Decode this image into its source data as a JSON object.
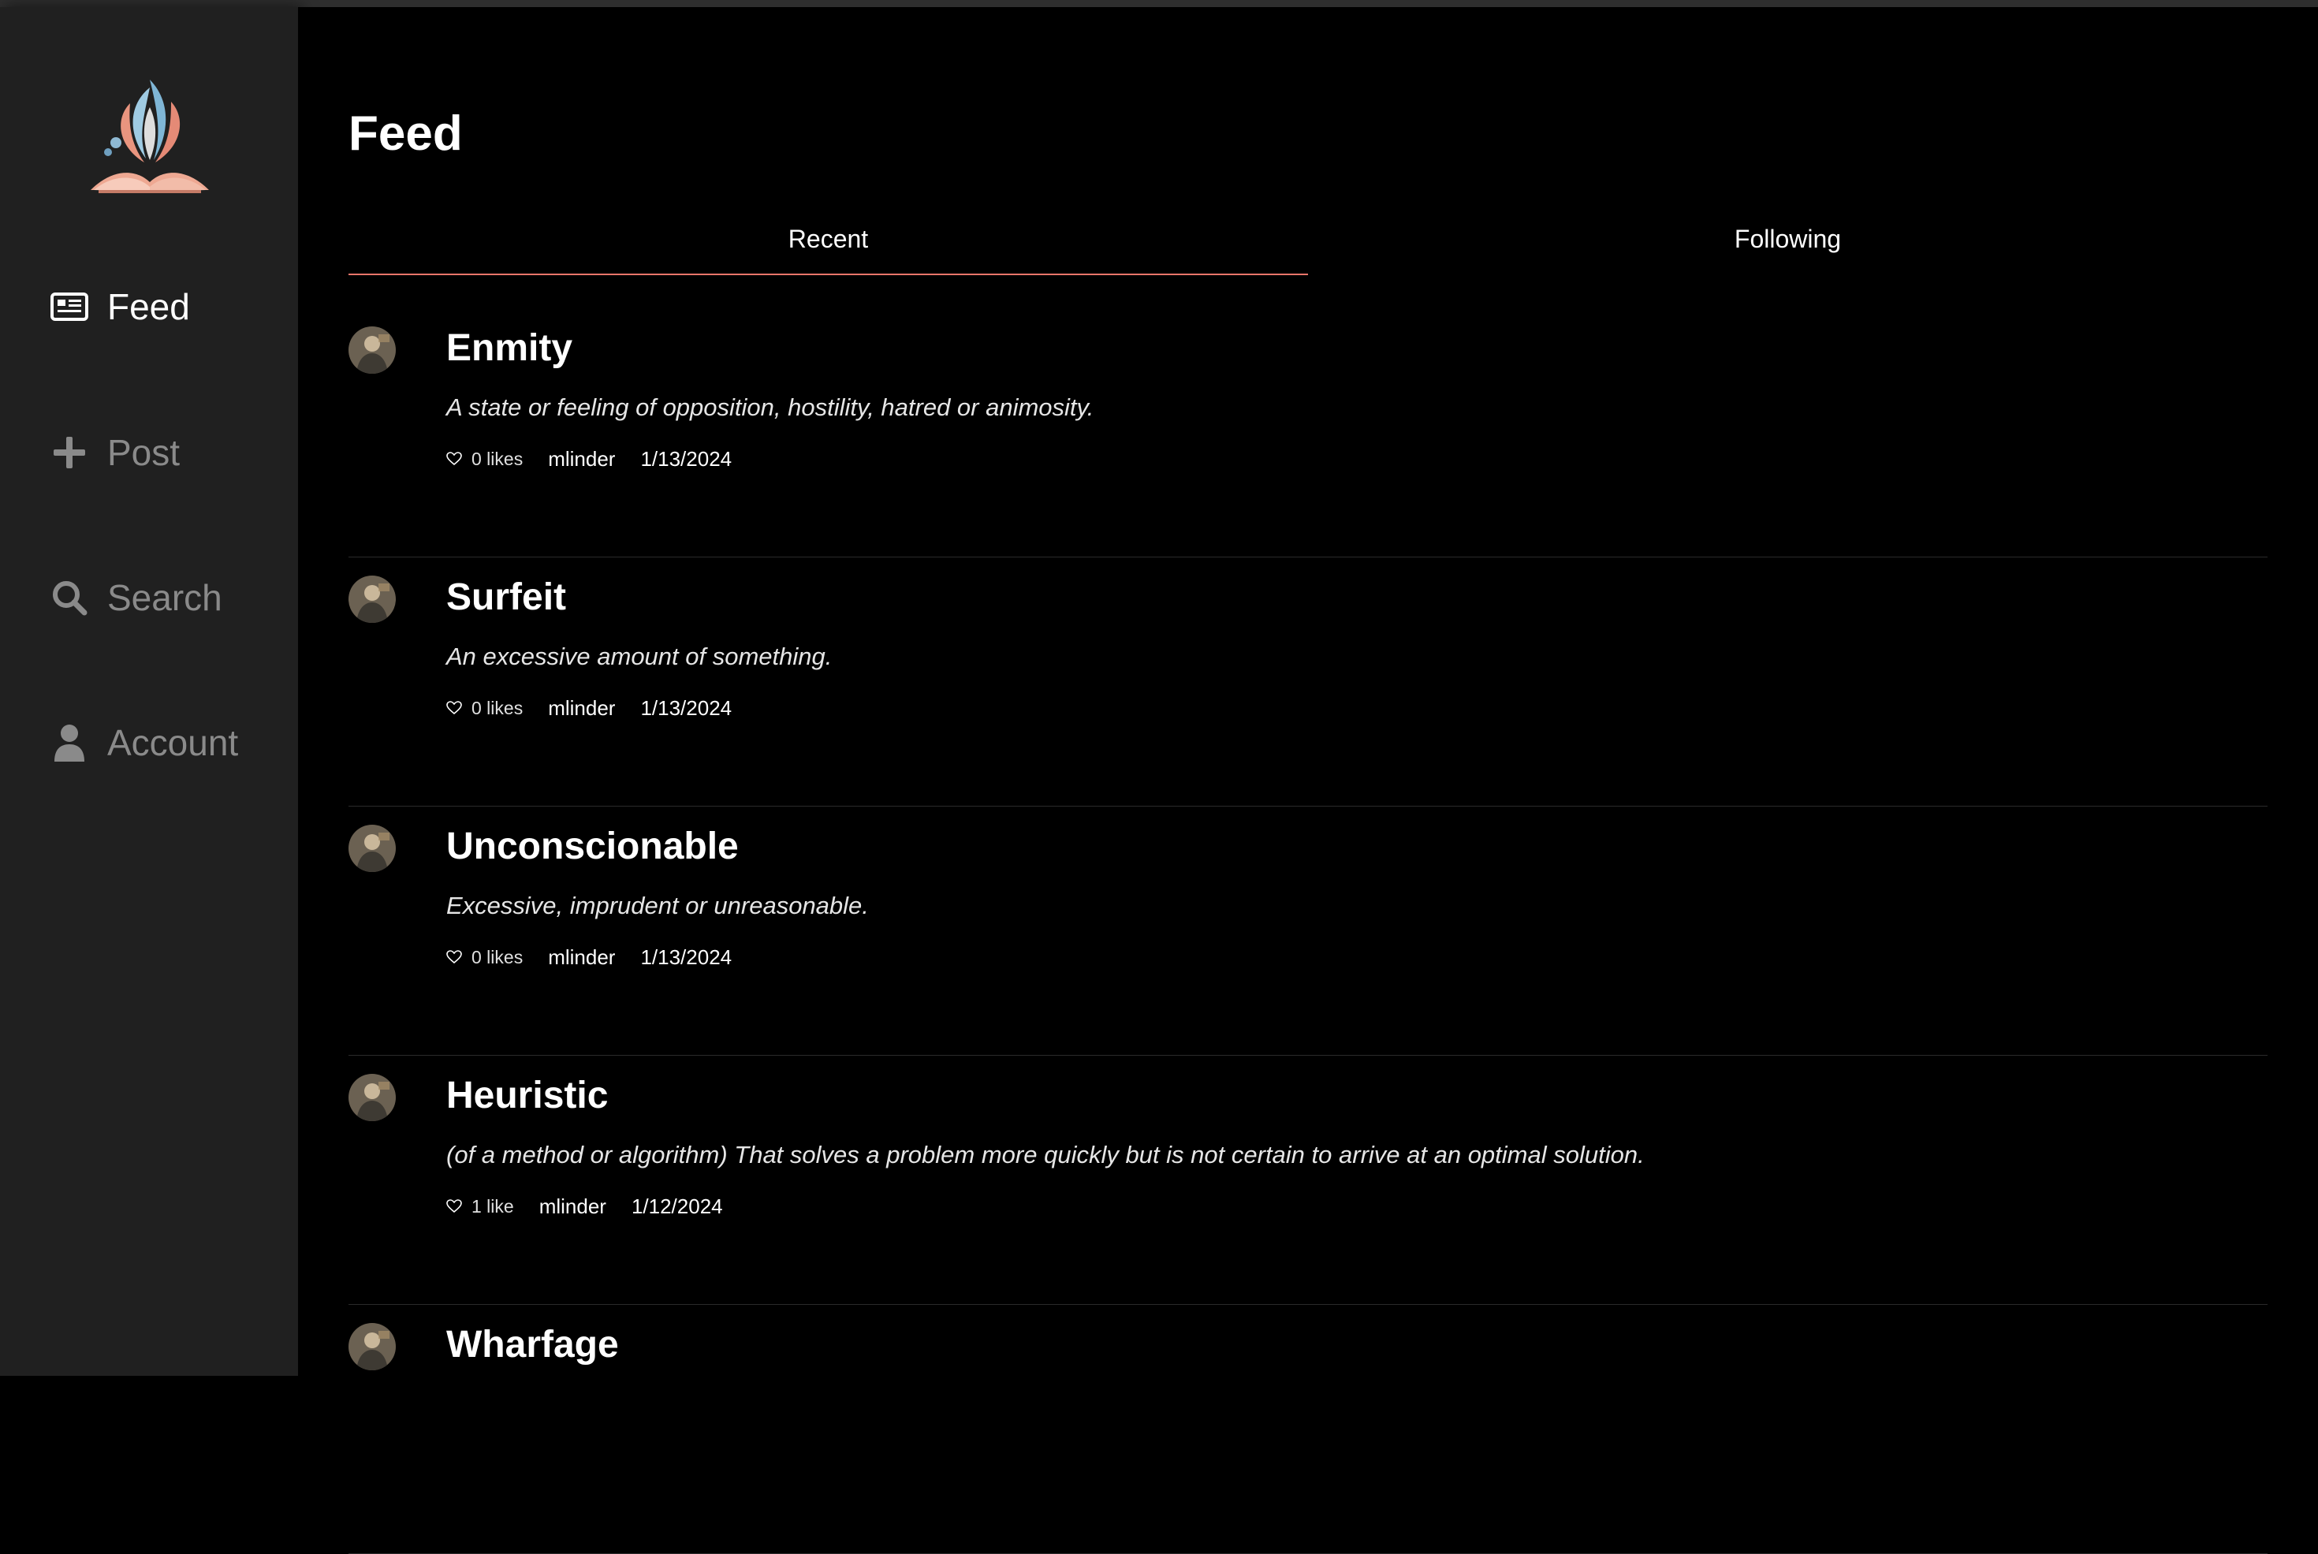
{
  "app": {
    "logo_name": "book-flame-logo"
  },
  "sidebar": {
    "items": [
      {
        "label": "Feed",
        "icon": "newspaper-icon",
        "active": true
      },
      {
        "label": "Post",
        "icon": "plus-icon",
        "active": false
      },
      {
        "label": "Search",
        "icon": "search-icon",
        "active": false
      },
      {
        "label": "Account",
        "icon": "user-icon",
        "active": false
      }
    ]
  },
  "main": {
    "title": "Feed",
    "tabs": [
      {
        "label": "Recent",
        "active": true
      },
      {
        "label": "Following",
        "active": false
      }
    ]
  },
  "posts": [
    {
      "word": "Enmity",
      "definition": "A state or feeling of opposition, hostility, hatred or animosity.",
      "likes": "0 likes",
      "author": "mlinder",
      "date": "1/13/2024"
    },
    {
      "word": "Surfeit",
      "definition": "An excessive amount of something.",
      "likes": "0 likes",
      "author": "mlinder",
      "date": "1/13/2024"
    },
    {
      "word": "Unconscionable",
      "definition": "Excessive, imprudent or unreasonable.",
      "likes": "0 likes",
      "author": "mlinder",
      "date": "1/13/2024"
    },
    {
      "word": "Heuristic",
      "definition": "(of a method or algorithm) That solves a problem more quickly but is not certain to arrive at an optimal solution.",
      "likes": "1 like",
      "author": "mlinder",
      "date": "1/12/2024"
    },
    {
      "word": "Wharfage",
      "definition": "",
      "likes": "",
      "author": "",
      "date": ""
    }
  ],
  "colors": {
    "accent": "#e8756a",
    "sidebar_bg": "#202020",
    "background": "#000000"
  }
}
